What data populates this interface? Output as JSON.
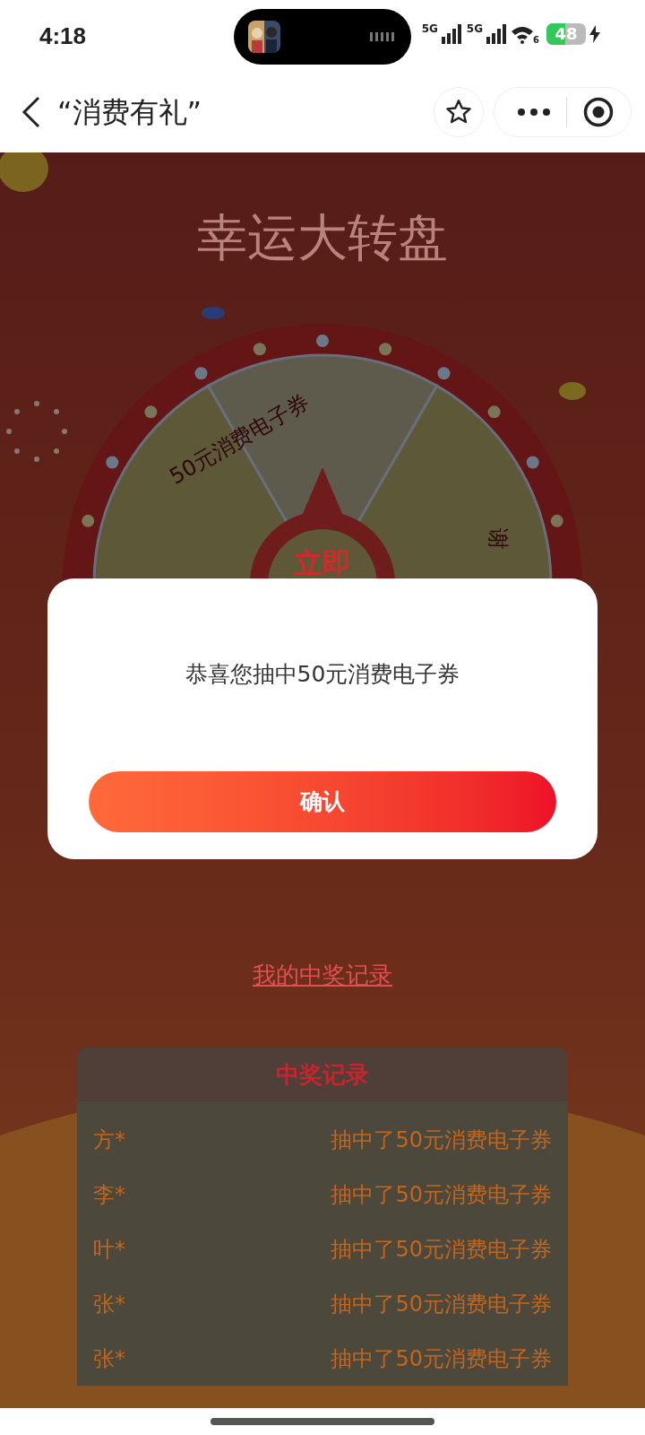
{
  "status_bar": {
    "time": "4:18",
    "network_1": "5G",
    "network_2": "5G",
    "wifi_badge": "6",
    "battery": "48",
    "charging": true
  },
  "nav_bar": {
    "title": "“消费有礼”"
  },
  "page": {
    "title": "幸运大转盘",
    "wheel": {
      "segments": [
        {
          "label": "50元消费电子券"
        },
        {
          "label": "谢"
        }
      ],
      "center_button": "立即"
    },
    "my_records_link": "我的中奖记录",
    "records": {
      "title": "中奖记录",
      "rows": [
        {
          "name": "方*",
          "prize": "抽中了50元消费电子券"
        },
        {
          "name": "李*",
          "prize": "抽中了50元消费电子券"
        },
        {
          "name": "叶*",
          "prize": "抽中了50元消费电子券"
        },
        {
          "name": "张*",
          "prize": "抽中了50元消费电子券"
        },
        {
          "name": "张*",
          "prize": "抽中了50元消费电子券"
        }
      ]
    }
  },
  "dialog": {
    "message": "恭喜您抽中50元消费电子券",
    "confirm_button": "确认"
  }
}
